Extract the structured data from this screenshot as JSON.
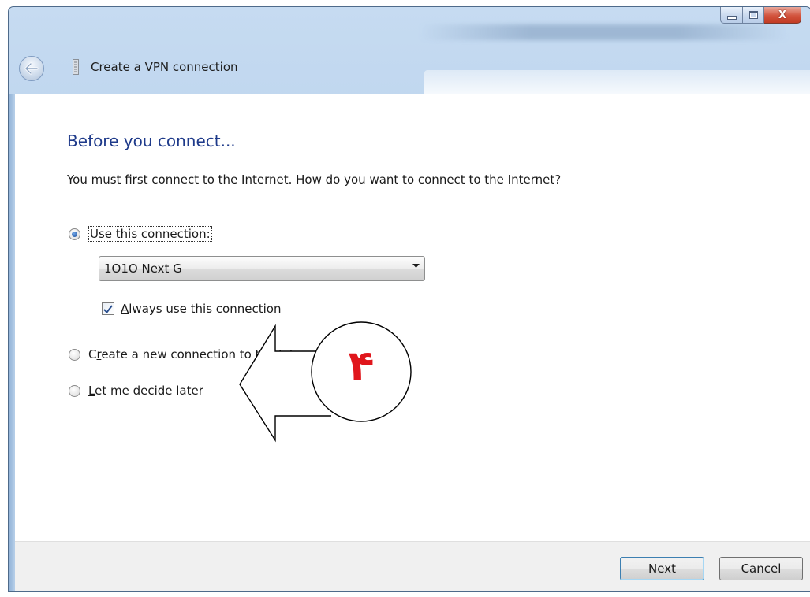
{
  "window": {
    "title": "Create a VPN connection",
    "caption_close": "X"
  },
  "content": {
    "heading": "Before you connect...",
    "question": "You must first connect to the Internet. How do you want to connect to the Internet?",
    "options": [
      {
        "label_acc": "U",
        "label_rest": "se this connection:",
        "selected": true
      },
      {
        "label_pre": "C",
        "label_acc": "r",
        "label_rest": "eate a new connection to the Internet",
        "selected": false
      },
      {
        "label_acc": "L",
        "label_rest": "et me decide later",
        "selected": false
      }
    ],
    "connection_select": {
      "value": "1O1O Next G"
    },
    "always_use": {
      "label_acc": "A",
      "label_rest": "lways use this connection",
      "checked": true
    }
  },
  "footer": {
    "next_label": "Next",
    "cancel_label": "Cancel"
  },
  "annotation": {
    "number": "۴",
    "color": "#e0161c"
  }
}
